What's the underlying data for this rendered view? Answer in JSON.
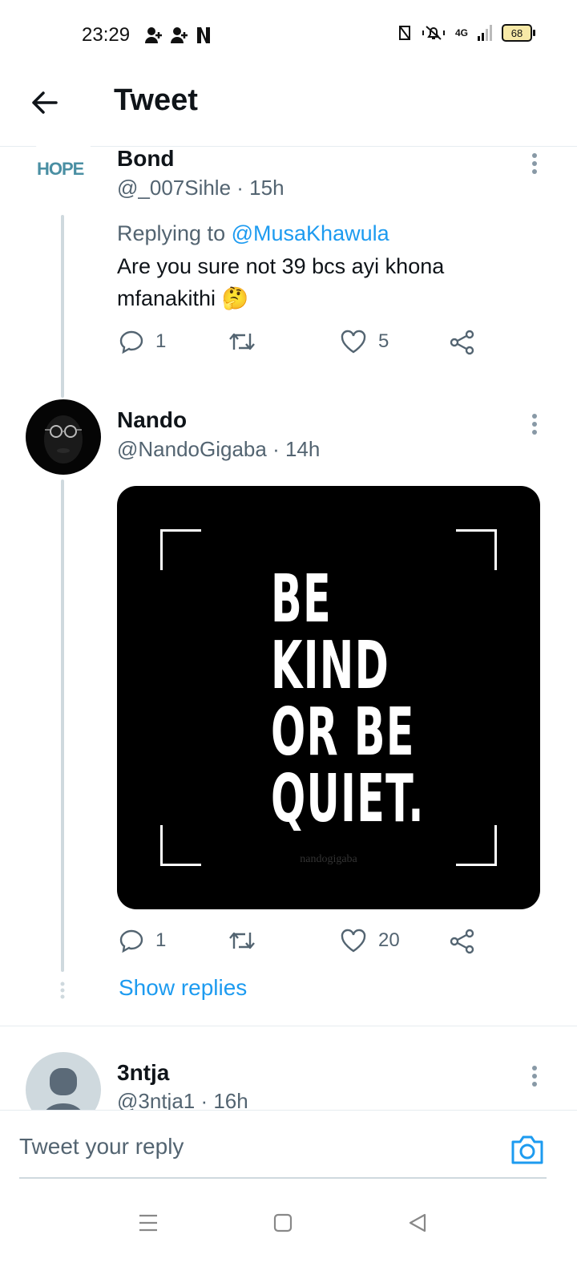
{
  "status_bar": {
    "time": "23:29",
    "network": "4G",
    "battery": "68"
  },
  "header": {
    "title": "Tweet"
  },
  "tweets": [
    {
      "name": "Bond",
      "handle": "@_007Sihle",
      "time": "15h",
      "avatar_text": "HOPE",
      "replying_label": "Replying to",
      "replying_to": "@MusaKhawula",
      "text": "Are you sure not 39 bcs ayi khona mfanakithi 🤔",
      "replies": "1",
      "retweets": "",
      "likes": "5"
    },
    {
      "name": "Nando",
      "handle": "@NandoGigaba",
      "time": "14h",
      "media_lines": [
        "BE",
        "KIND",
        "OR BE",
        "QUIET."
      ],
      "media_credit": "nandogigaba",
      "replies": "1",
      "retweets": "",
      "likes": "20",
      "show_replies": "Show replies"
    },
    {
      "name": "3ntja",
      "handle": "@3ntja1",
      "time": "16h"
    }
  ],
  "reply_bar": {
    "placeholder": "Tweet your reply"
  },
  "colors": {
    "accent": "#1d9bf0",
    "text": "#0f1419",
    "secondary": "#536471",
    "thread_line": "#cfd9de"
  },
  "icons": [
    "back-arrow-icon",
    "more-icon",
    "reply-icon",
    "retweet-icon",
    "like-icon",
    "share-icon",
    "camera-icon",
    "menu-icon",
    "home-icon",
    "back-nav-icon"
  ]
}
